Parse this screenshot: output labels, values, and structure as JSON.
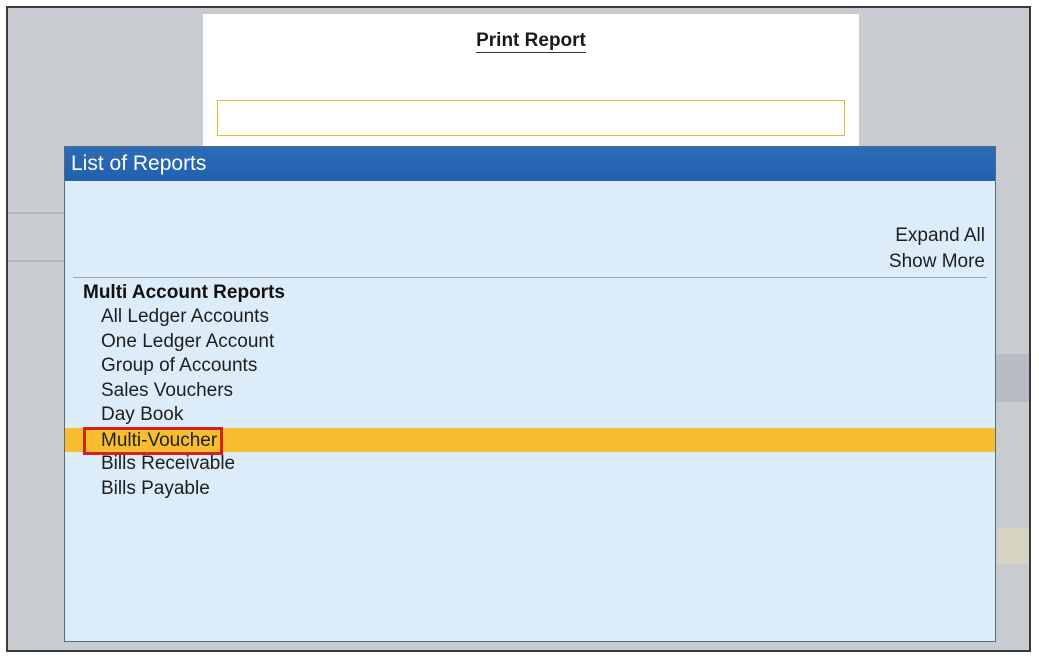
{
  "print_report": {
    "title": "Print Report",
    "input_value": ""
  },
  "list_of_reports": {
    "header": "List of Reports",
    "actions": {
      "expand_all": "Expand All",
      "show_more": "Show More"
    },
    "group": {
      "title": "Multi Account Reports",
      "items": [
        {
          "label": "All Ledger Accounts"
        },
        {
          "label": "One Ledger Account"
        },
        {
          "label": "Group of Accounts"
        },
        {
          "label": "Sales Vouchers"
        },
        {
          "label": "Day Book"
        },
        {
          "label": "Multi-Voucher"
        },
        {
          "label": "Bills Receivable"
        },
        {
          "label": "Bills Payable"
        }
      ],
      "selected_index": 5
    }
  },
  "colors": {
    "header_blue": "#2a6db8",
    "panel_bg": "#dcecf8",
    "highlight": "#f6be2e",
    "selection_box": "#d42020"
  }
}
